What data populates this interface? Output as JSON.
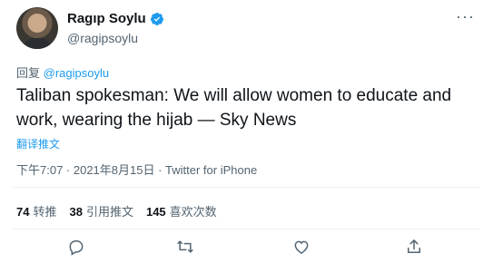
{
  "user": {
    "display_name": "Ragıp Soylu",
    "handle": "@ragipsoylu"
  },
  "reply": {
    "prefix": "回复",
    "handle": "@ragipsoylu"
  },
  "tweet": {
    "text": "Taliban spokesman: We will allow women to educate and work, wearing the hijab — Sky News",
    "translate_label": "翻译推文",
    "timestamp": "下午7:07 · 2021年8月15日 · Twitter for iPhone"
  },
  "stats": [
    {
      "count": "74",
      "label": "转推"
    },
    {
      "count": "38",
      "label": "引用推文"
    },
    {
      "count": "145",
      "label": "喜欢次数"
    }
  ],
  "icons": {
    "verified": "verified-badge-icon",
    "more": "more-icon",
    "reply": "reply-icon",
    "retweet": "retweet-icon",
    "like": "heart-icon",
    "share": "share-icon"
  },
  "colors": {
    "accent": "#1d9bf0",
    "secondary_text": "#536471",
    "primary_text": "#0f1419"
  }
}
